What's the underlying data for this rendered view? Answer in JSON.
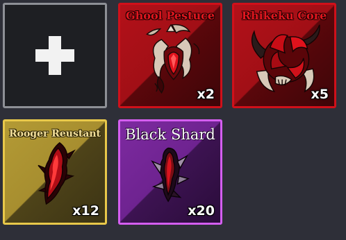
{
  "inventory": {
    "add_slot": {
      "icon": "plus-icon"
    },
    "items": [
      {
        "name": "Ghool Pestuce",
        "count": "x2",
        "rarity_color": "#d0101a",
        "icon": "ghoul-claw-icon"
      },
      {
        "name": "Rhikeku Core",
        "count": "x5",
        "rarity_color": "#d0101a",
        "icon": "rhikeku-core-icon"
      },
      {
        "name": "Rooger Reustant",
        "count": "x12",
        "rarity_color": "#e8c84a",
        "icon": "crimson-shard-icon"
      },
      {
        "name": "Black Shard",
        "count": "x20",
        "rarity_color": "#d45ef0",
        "icon": "black-shard-icon"
      }
    ]
  }
}
